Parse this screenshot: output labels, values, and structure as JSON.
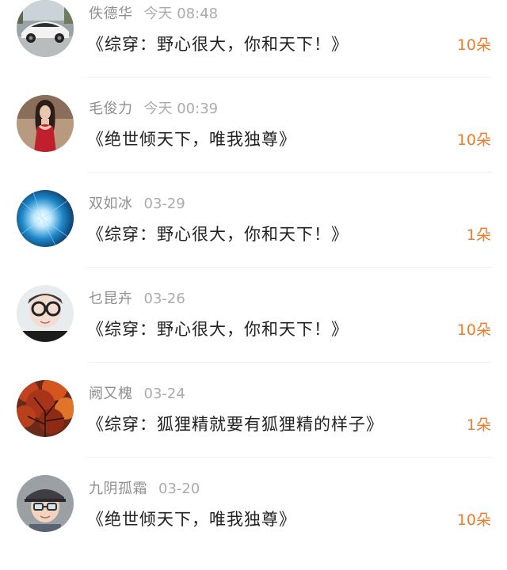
{
  "accent_color": "#f07b2a",
  "items": [
    {
      "avatar": "sports-car-avatar",
      "username": "佚德华",
      "time": "今天  08:48",
      "title": "《综穿：野心很大，你和天下！》",
      "count": "10朵"
    },
    {
      "avatar": "woman-red-dress-avatar",
      "username": "毛俊力",
      "time": "今天  00:39",
      "title": "《绝世倾天下，唯我独尊》",
      "count": "10朵"
    },
    {
      "avatar": "blue-tunnel-avatar",
      "username": "双如冰",
      "time": "03-29",
      "title": "《综穿：野心很大，你和天下！》",
      "count": "1朵"
    },
    {
      "avatar": "glasses-boy-avatar",
      "username": "乜昆卉",
      "time": "03-26",
      "title": "《综穿：野心很大，你和天下！》",
      "count": "10朵"
    },
    {
      "avatar": "autumn-tree-avatar",
      "username": "阙又槐",
      "time": "03-24",
      "title": "《综穿：狐狸精就要有狐狸精的样子》",
      "count": "1朵"
    },
    {
      "avatar": "cap-kid-avatar",
      "username": "九阴孤霜",
      "time": "03-20",
      "title": "《绝世倾天下，唯我独尊》",
      "count": "10朵"
    }
  ]
}
